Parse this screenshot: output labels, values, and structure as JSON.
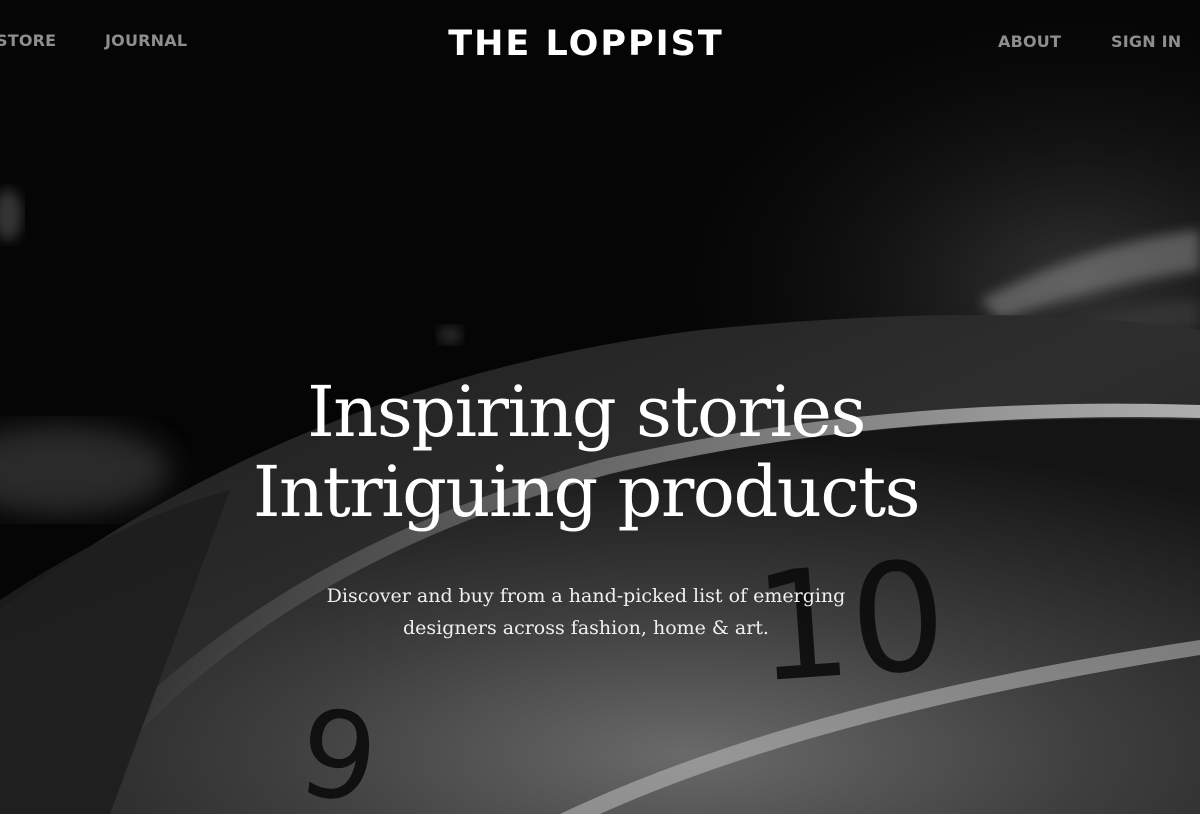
{
  "nav": {
    "store_label": "STORE",
    "journal_label": "JOURNAL",
    "logo_text": "THE LOPPIST",
    "about_label": "ABOUT",
    "signin_label": "SIGN IN"
  },
  "hero": {
    "headline_line1": "Inspiring stories",
    "headline_line2": "Intriguing products",
    "subtext_line1": "Discover and buy from a hand-picked list of emerging",
    "subtext_line2": "designers across fashion, home & art.",
    "watch_numeral_9": "9",
    "watch_numeral_10": "10"
  },
  "colors": {
    "background": "#050505",
    "nav_link": "#8e8e8e",
    "logo": "#ffffff",
    "headline": "#ffffff"
  }
}
